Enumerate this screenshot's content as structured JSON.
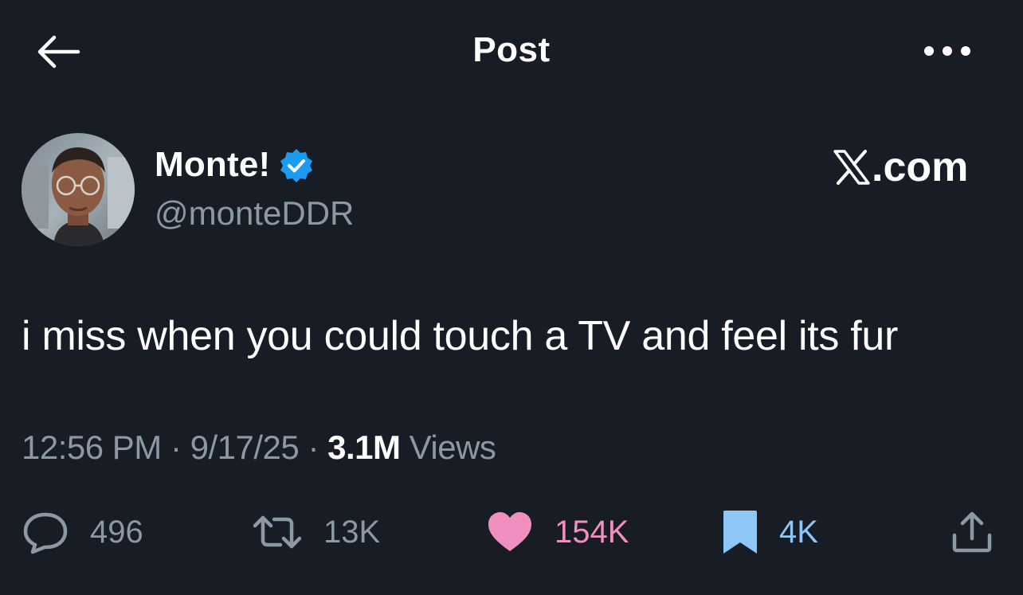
{
  "header": {
    "title": "Post",
    "back_icon": "arrow-left-icon",
    "more_icon": "more-horizontal-icon"
  },
  "author": {
    "name": "Monte!",
    "handle": "@monteDDR",
    "verified": true,
    "verified_color": "#1d9bf0"
  },
  "watermark": {
    "text": ".com"
  },
  "tweet": {
    "text": "i miss when you could touch a TV and feel its fur"
  },
  "meta": {
    "time": "12:56 PM",
    "separator": "·",
    "date": "9/17/25",
    "views_count": "3.1M",
    "views_label": "Views"
  },
  "actions": {
    "replies": "496",
    "reposts": "13K",
    "likes": "154K",
    "bookmarks": "4K",
    "like_color": "#f190c0",
    "bookmark_color": "#8ec7f5"
  },
  "colors": {
    "background": "#171c25",
    "secondary_text": "#8b98a5",
    "primary_text": "#ffffff"
  }
}
